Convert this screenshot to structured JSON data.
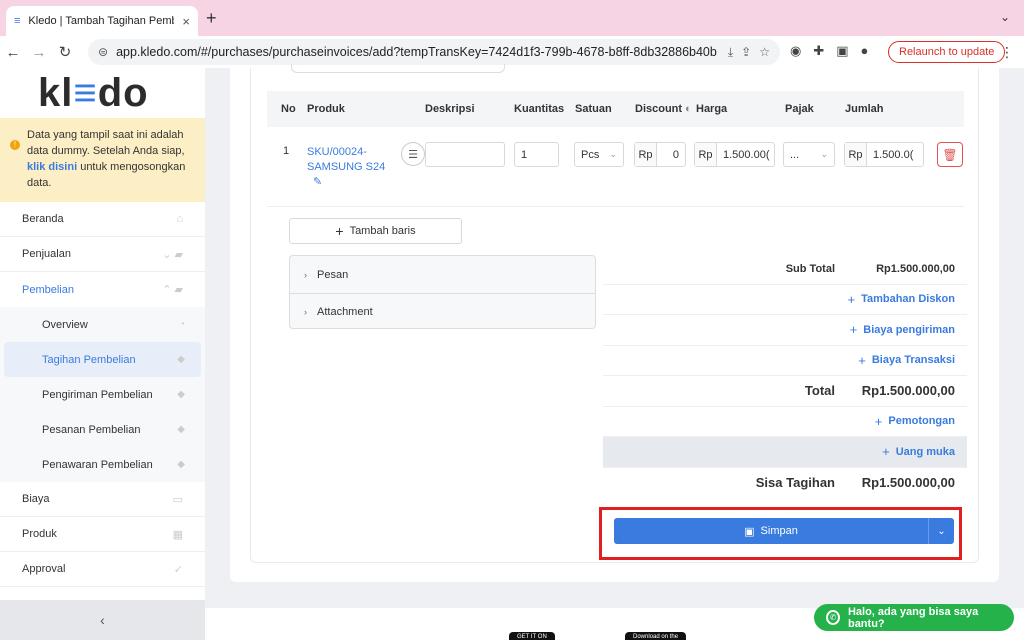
{
  "browser": {
    "tab_title": "Kledo | Tambah Tagihan Pemb",
    "url": "app.kledo.com/#/purchases/purchaseinvoices/add?tempTransKey=7424d1f3-799b-4678-b8ff-8db32886b40b",
    "relaunch_label": "Relaunch to update"
  },
  "sidebar": {
    "logo_left": "kl",
    "logo_mid": "≡",
    "logo_right": "do",
    "notice_pre": "Data yang tampil saat ini adalah data dummy. Setelah Anda siap, ",
    "notice_link": "klik disini",
    "notice_post": " untuk mengosongkan data.",
    "beranda": "Beranda",
    "penjualan": "Penjualan",
    "pembelian": "Pembelian",
    "sub": [
      "Overview",
      "Tagihan Pembelian",
      "Pengiriman Pembelian",
      "Pesanan Pembelian",
      "Penawaran Pembelian"
    ],
    "biaya": "Biaya",
    "produk": "Produk",
    "approval": "Approval"
  },
  "table": {
    "headers": [
      "No",
      "Produk",
      "Deskripsi",
      "Kuantitas",
      "Satuan",
      "Discount",
      "Harga",
      "Pajak",
      "Jumlah"
    ],
    "row": {
      "no": "1",
      "sku_line1": "SKU/00024-",
      "sku_line2": "SAMSUNG S24",
      "description": "",
      "quantity": "1",
      "unit": "Pcs",
      "discount_prefix": "Rp",
      "discount": "0",
      "price_prefix": "Rp",
      "price": "1.500.00(",
      "tax": "...",
      "amount_prefix": "Rp",
      "amount": "1.500.0("
    }
  },
  "add_row_label": "Tambah baris",
  "panels": [
    "Pesan",
    "Attachment"
  ],
  "summary": {
    "subtotal_label": "Sub Total",
    "subtotal": "Rp1.500.000,00",
    "tambahan_diskon": "Tambahan Diskon",
    "biaya_pengiriman": "Biaya pengiriman",
    "biaya_transaksi": "Biaya Transaksi",
    "total_label": "Total",
    "total": "Rp1.500.000,00",
    "pemotongan": "Pemotongan",
    "uang_muka": "Uang muka",
    "sisa_label": "Sisa Tagihan",
    "sisa": "Rp1.500.000,00"
  },
  "save_label": "Simpan",
  "chat_label": "Halo, ada yang bisa saya bantu?",
  "store_badges": [
    "GET IT ON",
    "Download on the"
  ]
}
